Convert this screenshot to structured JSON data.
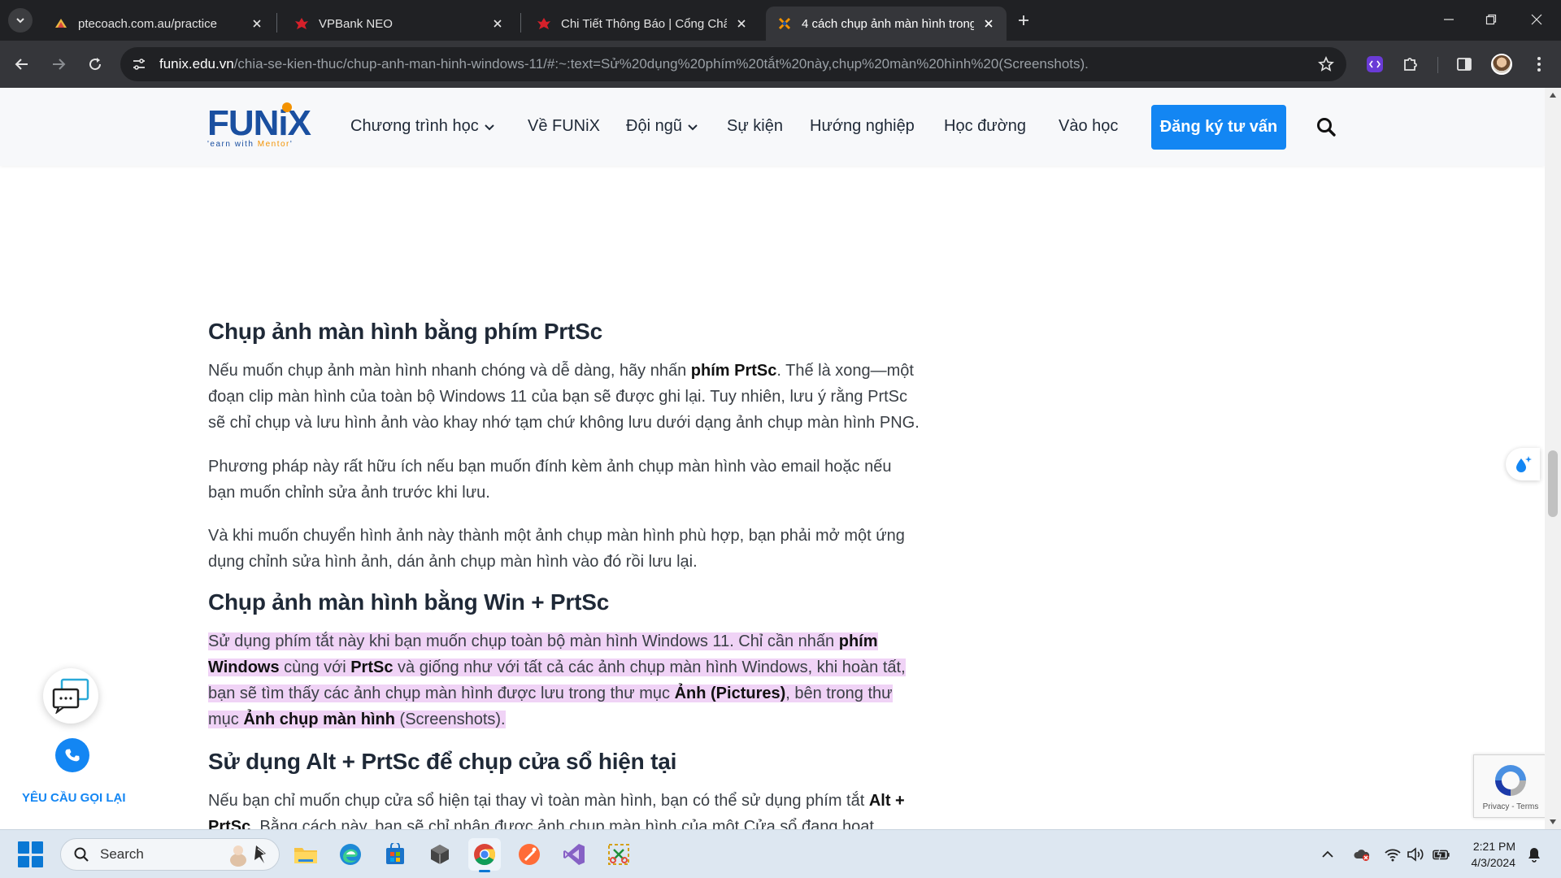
{
  "browser": {
    "tabs": [
      {
        "title": "ptecoach.com.au/practice",
        "favicon": "ptecoach-icon"
      },
      {
        "title": "VPBank NEO",
        "favicon": "vpbank-icon"
      },
      {
        "title": "Chi Tiết Thông Báo | Cổng Chân",
        "favicon": "vpbank-icon"
      },
      {
        "title": "4 cách chụp ảnh màn hình trong",
        "favicon": "funix-icon",
        "active": true
      }
    ],
    "url_host": "funix.edu.vn",
    "url_rest": "/chia-se-kien-thuc/chup-anh-man-hinh-windows-11/#:~:text=Sử%20dụng%20phím%20tắt%20này,chụp%20màn%20hình%20(Screenshots)."
  },
  "site": {
    "logo_text": "FUNiX",
    "logo_tagline_a": "'earn with ",
    "logo_tagline_b": "Mentor",
    "logo_tagline_c": "'",
    "nav": [
      {
        "label": "Chương trình học",
        "dropdown": true
      },
      {
        "label": "Về FUNiX",
        "dropdown": false
      },
      {
        "label": "Đội ngũ",
        "dropdown": true
      },
      {
        "label": "Sự kiện",
        "dropdown": false
      },
      {
        "label": "Hướng nghiệp",
        "dropdown": false
      },
      {
        "label": "Học đường",
        "dropdown": false
      },
      {
        "label": "Vào học",
        "dropdown": false
      }
    ],
    "cta": "Đăng ký tư vấn"
  },
  "article": {
    "h1": "Chụp ảnh màn hình bằng phím PrtSc",
    "p1": [
      [
        "Nếu muốn chụp ảnh màn hình nhanh chóng và dễ dàng, hãy nhấn ",
        "phím PrtSc",
        ". Thế là xong—một"
      ],
      [
        "đoạn clip màn hình của toàn bộ Windows 11 của bạn sẽ được ghi lại. Tuy nhiên, lưu ý rằng PrtSc"
      ],
      [
        "sẽ chỉ chụp và lưu hình ảnh vào khay nhớ tạm chứ không lưu dưới dạng ảnh chụp màn hình PNG."
      ]
    ],
    "p2": [
      [
        "Phương pháp này rất hữu ích nếu bạn muốn đính kèm ảnh chụp màn hình vào email hoặc nếu"
      ],
      [
        "bạn muốn chỉnh sửa ảnh trước khi lưu."
      ]
    ],
    "p3": [
      [
        "Và khi muốn chuyển hình ảnh này thành một ảnh chụp màn hình phù hợp, bạn phải mở một ứng"
      ],
      [
        "dụng chỉnh sửa hình ảnh, dán ảnh chụp màn hình vào đó rồi lưu lại."
      ]
    ],
    "h2": "Chụp ảnh màn hình bằng Win + PrtSc",
    "p4": [
      [
        "Sử dụng phím tắt này khi bạn muốn chụp toàn bộ màn hình Windows 11. Chỉ cần nhấn ",
        "phím",
        ""
      ],
      [
        "",
        "Windows",
        " cùng với ",
        "PrtSc",
        " và giống như với tất cả các ảnh chụp màn hình Windows, khi hoàn tất,"
      ],
      [
        "bạn sẽ tìm thấy các ảnh chụp màn hình được lưu trong thư mục ",
        "Ảnh (Pictures)",
        ", bên trong thư"
      ],
      [
        "mục ",
        "Ảnh chụp màn hình",
        " (Screenshots)."
      ]
    ],
    "h3": "Sử dụng Alt + PrtSc để chụp cửa sổ hiện tại",
    "p5": [
      [
        "Nếu bạn chỉ muốn chụp cửa sổ hiện tại thay vì toàn màn hình, bạn có thể sử dụng phím tắt ",
        "Alt +",
        ""
      ],
      [
        "",
        "PrtSc",
        ". Bằng cách này, bạn sẽ chỉ nhận được ảnh chụp màn hình của một Cửa sổ đang hoạt"
      ]
    ]
  },
  "widgets": {
    "callback_label": "YÊU CẦU GỌI LẠI",
    "recaptcha_text": "Privacy - Terms"
  },
  "taskbar": {
    "search_placeholder": "Search",
    "time": "2:21 PM",
    "date": "4/3/2024"
  },
  "colors": {
    "accent": "#1386f3",
    "highlight": "#f0d3f6",
    "brand_blue": "#1a4fa0",
    "brand_orange": "#f39200"
  }
}
